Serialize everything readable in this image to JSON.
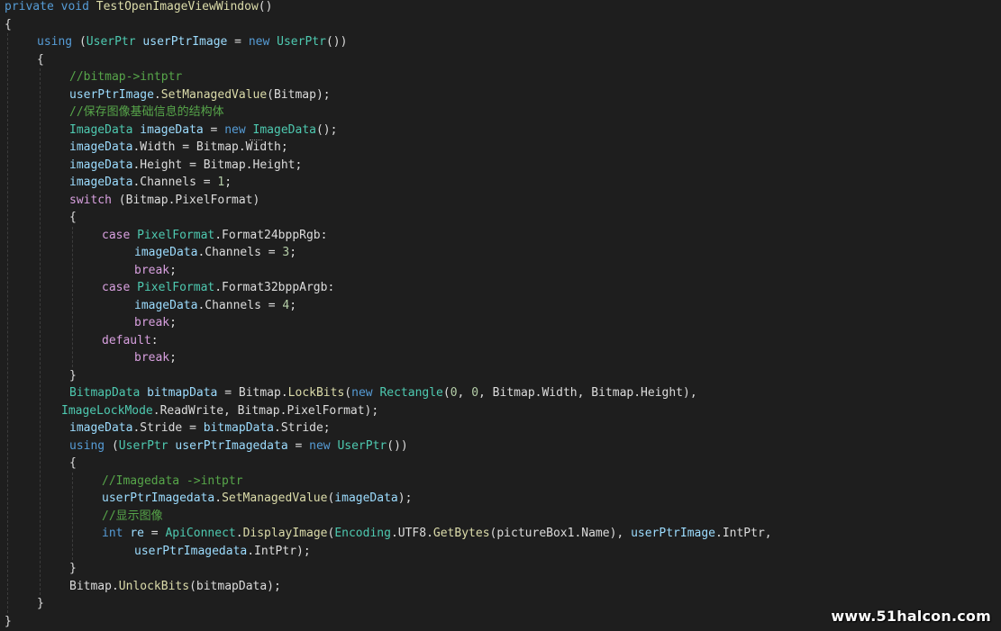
{
  "colors": {
    "background": "#1e1e1e",
    "keyword": "#569cd6",
    "control_keyword": "#d8a0df",
    "type": "#4ec9b0",
    "identifier": "#9cdcfe",
    "method": "#dcdcaa",
    "comment": "#57a64a",
    "number": "#b5cea8",
    "plain": "#dcdcdc"
  },
  "code": {
    "lines": [
      {
        "indent": 0,
        "tokens": [
          {
            "t": "private",
            "k": "keyword"
          },
          {
            "t": " "
          },
          {
            "t": "void",
            "k": "keyword"
          },
          {
            "t": " "
          },
          {
            "t": "TestOpenImageViewWindow",
            "k": "method"
          },
          {
            "t": "()"
          }
        ]
      },
      {
        "indent": 0,
        "tokens": [
          {
            "t": "{"
          }
        ]
      },
      {
        "indent": 4,
        "tokens": [
          {
            "t": "using",
            "k": "keyword"
          },
          {
            "t": " ("
          },
          {
            "t": "UserPtr",
            "k": "type"
          },
          {
            "t": " "
          },
          {
            "t": "userPtrImage",
            "k": "identifier"
          },
          {
            "t": " = "
          },
          {
            "t": "new",
            "k": "keyword"
          },
          {
            "t": " "
          },
          {
            "t": "UserPtr",
            "k": "type"
          },
          {
            "t": "())"
          }
        ]
      },
      {
        "indent": 4,
        "tokens": [
          {
            "t": "{"
          }
        ]
      },
      {
        "indent": 8,
        "tokens": [
          {
            "t": "//bitmap->intptr",
            "k": "comment"
          }
        ]
      },
      {
        "indent": 8,
        "tokens": [
          {
            "t": "userPtrImage",
            "k": "identifier"
          },
          {
            "t": "."
          },
          {
            "t": "SetManagedValue",
            "k": "method"
          },
          {
            "t": "(Bitmap);"
          }
        ]
      },
      {
        "indent": 8,
        "tokens": [
          {
            "t": "//保存图像基础信息的结构体",
            "k": "comment"
          }
        ]
      },
      {
        "indent": 8,
        "tokens": [
          {
            "t": "ImageData",
            "k": "type"
          },
          {
            "t": " "
          },
          {
            "t": "imageData",
            "k": "identifier"
          },
          {
            "t": " = "
          },
          {
            "t": "new",
            "k": "keyword",
            "squiggle": true
          },
          {
            "t": " "
          },
          {
            "t": "ImageData",
            "k": "type"
          },
          {
            "t": "();"
          }
        ]
      },
      {
        "indent": 8,
        "tokens": [
          {
            "t": "imageData",
            "k": "identifier"
          },
          {
            "t": ".Width = Bitmap.Width;"
          }
        ]
      },
      {
        "indent": 8,
        "tokens": [
          {
            "t": "imageData",
            "k": "identifier"
          },
          {
            "t": ".Height = Bitmap.Height;"
          }
        ]
      },
      {
        "indent": 8,
        "tokens": [
          {
            "t": "imageData",
            "k": "identifier"
          },
          {
            "t": ".Channels = "
          },
          {
            "t": "1",
            "k": "number"
          },
          {
            "t": ";"
          }
        ]
      },
      {
        "indent": 8,
        "tokens": [
          {
            "t": "switch",
            "k": "control_keyword"
          },
          {
            "t": " (Bitmap.PixelFormat)"
          }
        ]
      },
      {
        "indent": 8,
        "tokens": [
          {
            "t": "{"
          }
        ]
      },
      {
        "indent": 12,
        "tokens": [
          {
            "t": "case",
            "k": "control_keyword"
          },
          {
            "t": " "
          },
          {
            "t": "PixelFormat",
            "k": "type"
          },
          {
            "t": ".Format24bppRgb:"
          }
        ]
      },
      {
        "indent": 16,
        "tokens": [
          {
            "t": "imageData",
            "k": "identifier"
          },
          {
            "t": ".Channels = "
          },
          {
            "t": "3",
            "k": "number"
          },
          {
            "t": ";"
          }
        ]
      },
      {
        "indent": 16,
        "tokens": [
          {
            "t": "break",
            "k": "control_keyword"
          },
          {
            "t": ";"
          }
        ]
      },
      {
        "indent": 12,
        "tokens": [
          {
            "t": "case",
            "k": "control_keyword"
          },
          {
            "t": " "
          },
          {
            "t": "PixelFormat",
            "k": "type"
          },
          {
            "t": ".Format32bppArgb:"
          }
        ]
      },
      {
        "indent": 16,
        "tokens": [
          {
            "t": "imageData",
            "k": "identifier"
          },
          {
            "t": ".Channels = "
          },
          {
            "t": "4",
            "k": "number"
          },
          {
            "t": ";"
          }
        ]
      },
      {
        "indent": 16,
        "tokens": [
          {
            "t": "break",
            "k": "control_keyword"
          },
          {
            "t": ";"
          }
        ]
      },
      {
        "indent": 12,
        "tokens": [
          {
            "t": "default",
            "k": "control_keyword"
          },
          {
            "t": ":"
          }
        ]
      },
      {
        "indent": 16,
        "tokens": [
          {
            "t": "break",
            "k": "control_keyword"
          },
          {
            "t": ";"
          }
        ]
      },
      {
        "indent": 8,
        "tokens": [
          {
            "t": "}"
          }
        ]
      },
      {
        "indent": 8,
        "tokens": [
          {
            "t": "BitmapData",
            "k": "type"
          },
          {
            "t": " "
          },
          {
            "t": "bitmapData",
            "k": "identifier"
          },
          {
            "t": " = Bitmap."
          },
          {
            "t": "LockBits",
            "k": "method"
          },
          {
            "t": "("
          },
          {
            "t": "new",
            "k": "keyword"
          },
          {
            "t": " "
          },
          {
            "t": "Rectangle",
            "k": "type"
          },
          {
            "t": "("
          },
          {
            "t": "0",
            "k": "number"
          },
          {
            "t": ", "
          },
          {
            "t": "0",
            "k": "number"
          },
          {
            "t": ", Bitmap.Width, Bitmap.Height),"
          }
        ]
      },
      {
        "indent": 7,
        "tokens": [
          {
            "t": "ImageLockMode",
            "k": "type"
          },
          {
            "t": ".ReadWrite, Bitmap.PixelFormat);"
          }
        ]
      },
      {
        "indent": 8,
        "tokens": [
          {
            "t": "imageData",
            "k": "identifier"
          },
          {
            "t": ".Stride = "
          },
          {
            "t": "bitmapData",
            "k": "identifier"
          },
          {
            "t": ".Stride;"
          }
        ]
      },
      {
        "indent": 8,
        "tokens": [
          {
            "t": "using",
            "k": "keyword"
          },
          {
            "t": " ("
          },
          {
            "t": "UserPtr",
            "k": "type"
          },
          {
            "t": " "
          },
          {
            "t": "userPtrImagedata",
            "k": "identifier"
          },
          {
            "t": " = "
          },
          {
            "t": "new",
            "k": "keyword"
          },
          {
            "t": " "
          },
          {
            "t": "UserPtr",
            "k": "type"
          },
          {
            "t": "())"
          }
        ]
      },
      {
        "indent": 8,
        "tokens": [
          {
            "t": "{"
          }
        ]
      },
      {
        "indent": 12,
        "tokens": [
          {
            "t": "//Imagedata ->intptr",
            "k": "comment"
          }
        ]
      },
      {
        "indent": 12,
        "tokens": [
          {
            "t": "userPtrImagedata",
            "k": "identifier"
          },
          {
            "t": "."
          },
          {
            "t": "SetManagedValue",
            "k": "method"
          },
          {
            "t": "("
          },
          {
            "t": "imageData",
            "k": "identifier"
          },
          {
            "t": ");"
          }
        ]
      },
      {
        "indent": 12,
        "tokens": [
          {
            "t": "//显示图像",
            "k": "comment"
          }
        ]
      },
      {
        "indent": 12,
        "tokens": [
          {
            "t": "int",
            "k": "keyword"
          },
          {
            "t": " "
          },
          {
            "t": "re",
            "k": "identifier"
          },
          {
            "t": " = "
          },
          {
            "t": "ApiConnect",
            "k": "type"
          },
          {
            "t": "."
          },
          {
            "t": "DisplayImage",
            "k": "method"
          },
          {
            "t": "("
          },
          {
            "t": "Encoding",
            "k": "type"
          },
          {
            "t": ".UTF8."
          },
          {
            "t": "GetBytes",
            "k": "method"
          },
          {
            "t": "(pictureBox1.Name), "
          },
          {
            "t": "userPtrImage",
            "k": "identifier"
          },
          {
            "t": ".IntPtr,"
          }
        ]
      },
      {
        "indent": 16,
        "tokens": [
          {
            "t": "userPtrImagedata",
            "k": "identifier"
          },
          {
            "t": ".IntPtr);"
          }
        ]
      },
      {
        "indent": 8,
        "tokens": [
          {
            "t": "}"
          }
        ]
      },
      {
        "indent": 8,
        "tokens": [
          {
            "t": "Bitmap."
          },
          {
            "t": "UnlockBits",
            "k": "method"
          },
          {
            "t": "(bitmapData);"
          }
        ]
      },
      {
        "indent": 4,
        "tokens": [
          {
            "t": "}"
          }
        ]
      },
      {
        "indent": 0,
        "tokens": [
          {
            "t": "}"
          }
        ]
      }
    ]
  },
  "watermark": "www.51halcon.com"
}
